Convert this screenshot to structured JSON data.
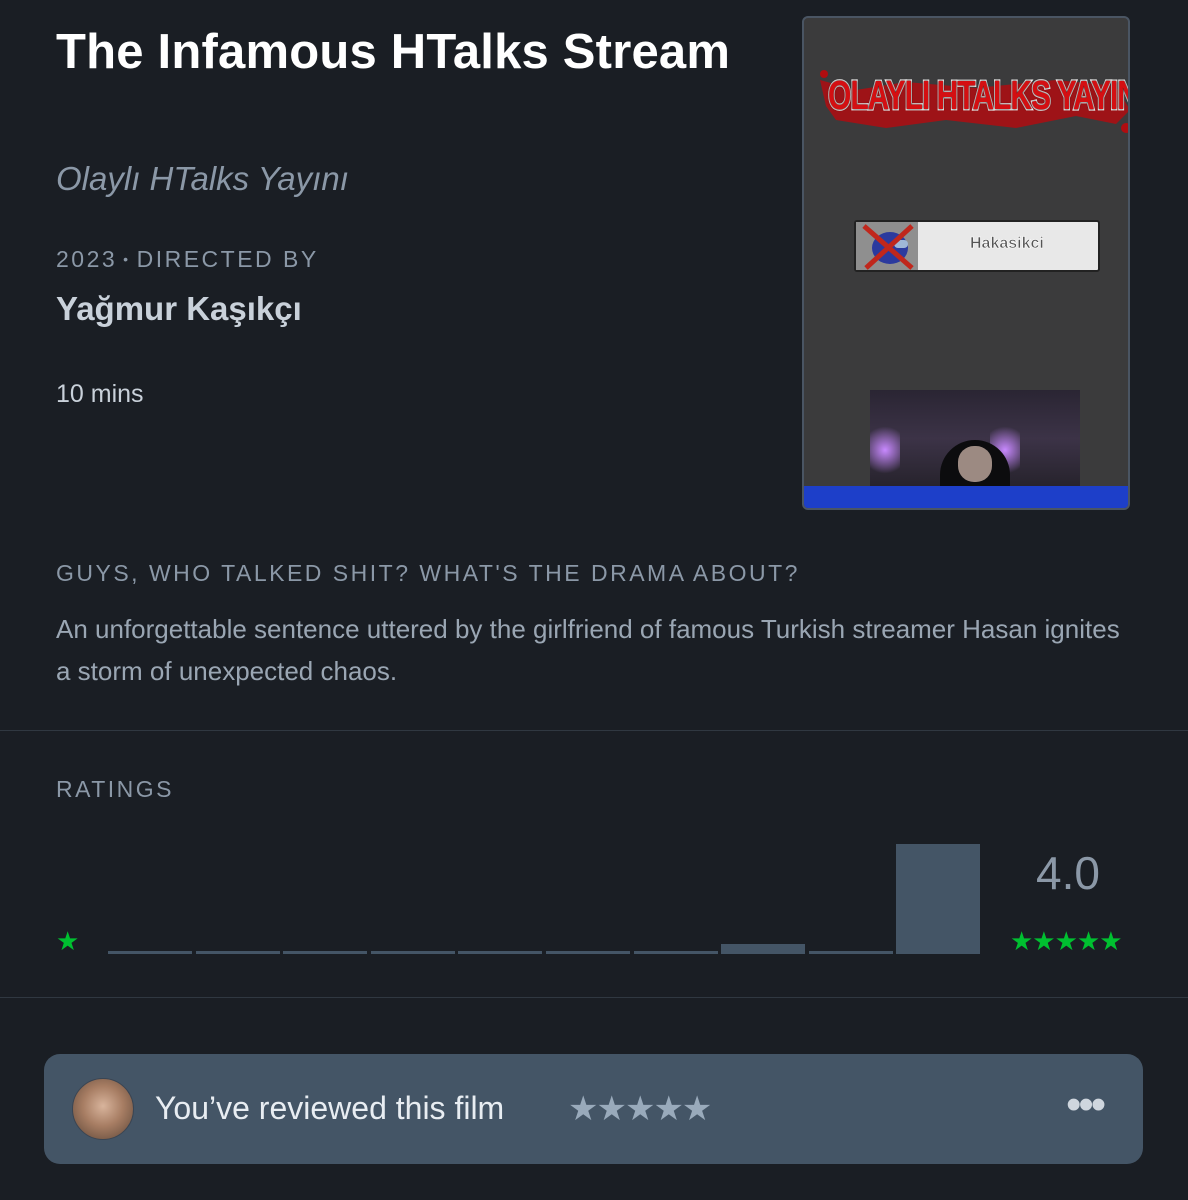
{
  "film": {
    "title": "The Infamous HTalks Stream",
    "original_title": "Olaylı HTalks Yayını",
    "year": "2023",
    "directed_by_label": "DIRECTED BY",
    "director": "Yağmur Kaşıkçı",
    "runtime": "10 mins",
    "tagline": "GUYS, WHO TALKED SHIT? WHAT'S THE DRAMA ABOUT?",
    "synopsis": "An unforgettable sentence uttered by the girlfriend of famous Turkish streamer Hasan ignites a storm of unexpected chaos."
  },
  "poster": {
    "headline": "OLAYLI HTALKS YAYINI",
    "chip_name": "Hakasikci"
  },
  "ratings": {
    "label": "RATINGS",
    "average": "4.0",
    "min_star": "★",
    "max_stars": "★★★★★",
    "star_color": "#00c030"
  },
  "chart_data": {
    "type": "bar",
    "categories": [
      "0.5",
      "1",
      "1.5",
      "2",
      "2.5",
      "3",
      "3.5",
      "4",
      "4.5",
      "5"
    ],
    "values": [
      0.02,
      0.02,
      0.02,
      0.02,
      0.02,
      0.02,
      0.02,
      0.09,
      0.03,
      1.0
    ],
    "ylim": [
      0,
      1
    ]
  },
  "review": {
    "text": "You’ve reviewed this film",
    "stars": "★★★★★",
    "more": "•••"
  },
  "colors": {
    "background": "#1a1e24",
    "panel": "#445566",
    "muted_text": "#8b98a7"
  }
}
